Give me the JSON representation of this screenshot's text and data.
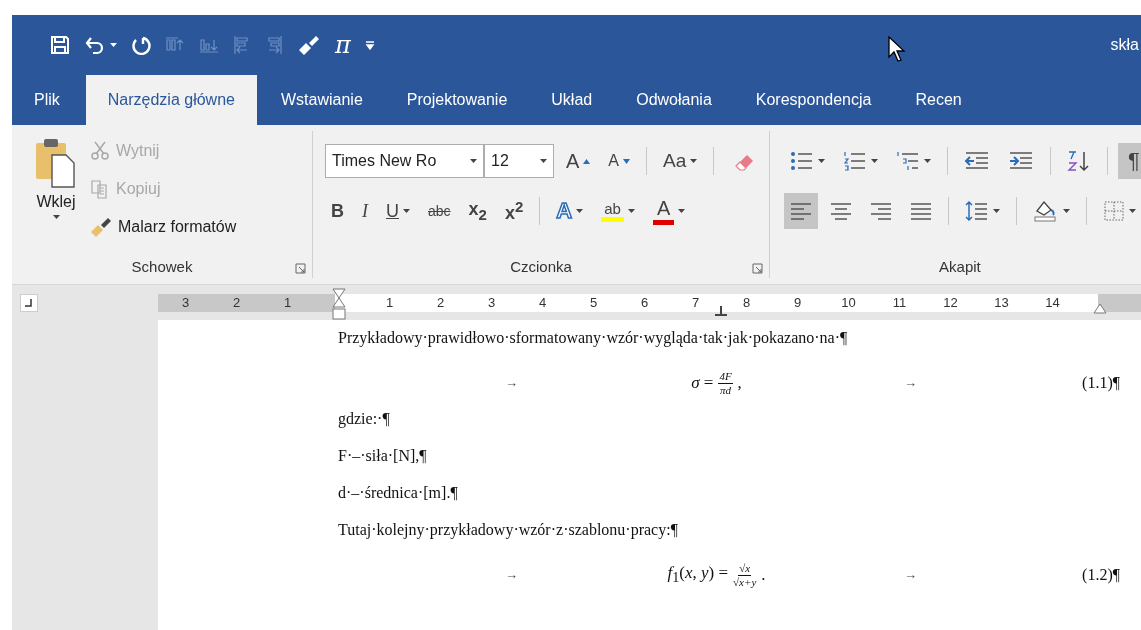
{
  "window": {
    "title": "skła"
  },
  "quick_access": [
    {
      "kind": "save",
      "disabled": false
    },
    {
      "kind": "undo",
      "disabled": false
    },
    {
      "kind": "redo",
      "disabled": false
    },
    {
      "kind": "insert-above",
      "disabled": true
    },
    {
      "kind": "insert-below",
      "disabled": true
    },
    {
      "kind": "insert-left",
      "disabled": true
    },
    {
      "kind": "insert-right",
      "disabled": true
    },
    {
      "kind": "painter",
      "disabled": false
    },
    {
      "kind": "equation",
      "label": "π",
      "disabled": false
    },
    {
      "kind": "customize",
      "disabled": false
    }
  ],
  "tabs": [
    {
      "label": "Plik",
      "selected": false
    },
    {
      "label": "Narzędzia główne",
      "selected": true
    },
    {
      "label": "Wstawianie",
      "selected": false
    },
    {
      "label": "Projektowanie",
      "selected": false
    },
    {
      "label": "Układ",
      "selected": false
    },
    {
      "label": "Odwołania",
      "selected": false
    },
    {
      "label": "Korespondencja",
      "selected": false
    },
    {
      "label": "Recen",
      "selected": false
    }
  ],
  "clipboard": {
    "title": "Schowek",
    "paste": {
      "label": "Wklej"
    },
    "buttons": [
      {
        "kind": "cut",
        "label": "Wytnij",
        "disabled": true
      },
      {
        "kind": "copy",
        "label": "Kopiuj",
        "disabled": true
      },
      {
        "kind": "painter",
        "label": "Malarz formatów",
        "disabled": false
      }
    ]
  },
  "font": {
    "title": "Czcionka",
    "font_name": "Times New Ro",
    "font_size": "12",
    "row1": [
      {
        "kind": "grow",
        "label": "A"
      },
      {
        "kind": "shrink",
        "label": "A"
      },
      {
        "kind": "case",
        "label": "Aa"
      },
      {
        "kind": "clear"
      }
    ],
    "row2": [
      {
        "kind": "bold",
        "label": "B"
      },
      {
        "kind": "italic",
        "label": "I"
      },
      {
        "kind": "underline",
        "label": "U"
      },
      {
        "kind": "strike",
        "label": "abc"
      },
      {
        "kind": "subscript",
        "label": "x$_{2}$"
      },
      {
        "kind": "superscript",
        "label": "x$^{2}$"
      },
      {
        "kind": "effects",
        "label": "A"
      },
      {
        "kind": "highlight",
        "label": "ab"
      },
      {
        "kind": "color",
        "label": "A"
      }
    ]
  },
  "paragraph": {
    "title": "Akapit",
    "row1": [
      {
        "kind": "bullets"
      },
      {
        "kind": "numbering"
      },
      {
        "kind": "multilevel"
      },
      {
        "kind": "outdent"
      },
      {
        "kind": "indent"
      },
      {
        "kind": "sort"
      },
      {
        "kind": "marks",
        "label": "¶",
        "on": true
      }
    ],
    "alignment": [
      {
        "kind": "left",
        "selected": true
      },
      {
        "kind": "center",
        "selected": false
      },
      {
        "kind": "right",
        "selected": false
      },
      {
        "kind": "justify",
        "selected": false
      }
    ],
    "row2": [
      {
        "kind": "spacing"
      },
      {
        "kind": "shading"
      },
      {
        "kind": "borders"
      }
    ]
  },
  "ruler": {
    "left_labels": [
      "3",
      "2",
      "1"
    ],
    "right_labels": [
      "1",
      "2",
      "3",
      "4",
      "5",
      "6",
      "7",
      "8",
      "9",
      "10",
      "11",
      "12",
      "13",
      "14"
    ]
  },
  "document": [
    {
      "kind": "text",
      "text": "Przykładowy·prawidłowo·sformatowany·wzór·wygląda·tak·jak·pokazano·na·¶"
    },
    {
      "kind": "equation",
      "arrow": "→",
      "lhs": "*σ* =",
      "numerator": "4F",
      "denominator": "πd",
      "tail": ",",
      "arrow_after": "→",
      "number": "(1.1)¶"
    },
    {
      "kind": "text",
      "text": "gdzie:·¶"
    },
    {
      "kind": "text",
      "text": "F·–·siła·[N],¶"
    },
    {
      "kind": "text",
      "text": "d·–·średnica·[m].¶"
    },
    {
      "kind": "text",
      "text": "Tutaj·kolejny·przykładowy·wzór·z·szablonu·pracy:¶"
    },
    {
      "kind": "equation",
      "arrow": "→",
      "lhs": "*f*$_{1}$(*x*, *y*) =",
      "numerator": "√x",
      "denominator": "√x+y",
      "tail": ".",
      "arrow_after": "→",
      "number": "(1.2)¶"
    }
  ]
}
